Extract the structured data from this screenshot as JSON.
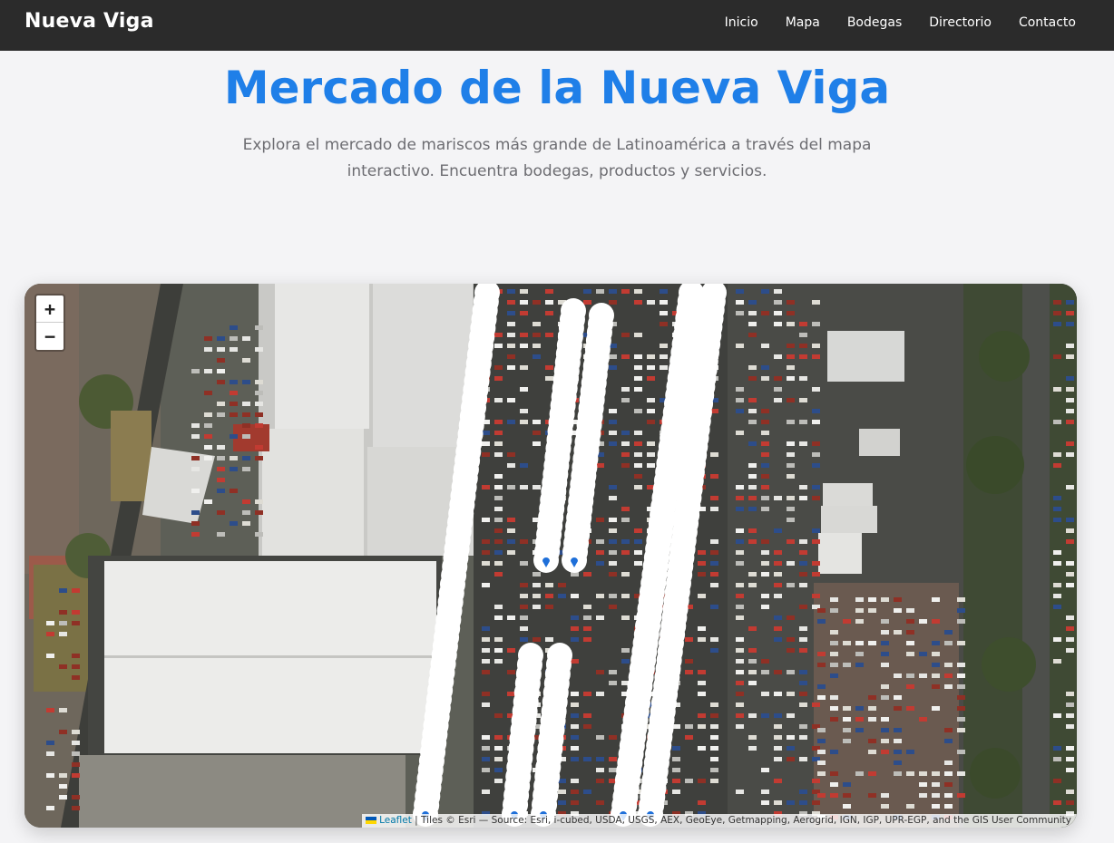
{
  "navbar": {
    "brand": "Nueva Viga",
    "links": [
      "Inicio",
      "Mapa",
      "Bodegas",
      "Directorio",
      "Contacto"
    ]
  },
  "hero": {
    "title": "Mercado de la Nueva Viga",
    "subtitle_line1": "Explora el mercado de mariscos más grande de Latinoamérica a través del mapa",
    "subtitle_line2": "interactivo. Encuentra bodegas, productos y servicios."
  },
  "map": {
    "zoom_in": "+",
    "zoom_out": "−",
    "attribution": {
      "leaflet": "Leaflet",
      "tiles": " | Tiles © Esri — Source: Esri, i-cubed, USDA, USGS, AEX, GeoEye, Getmapping, Aerogrid, IGN, IGP, UPR-EGP, and the GIS User Community"
    },
    "marker_color": "#1e6fd9"
  },
  "colors": {
    "navbar": "#2b2b2b",
    "title": "#1f7fe8",
    "subtitle": "#6d6d72"
  }
}
